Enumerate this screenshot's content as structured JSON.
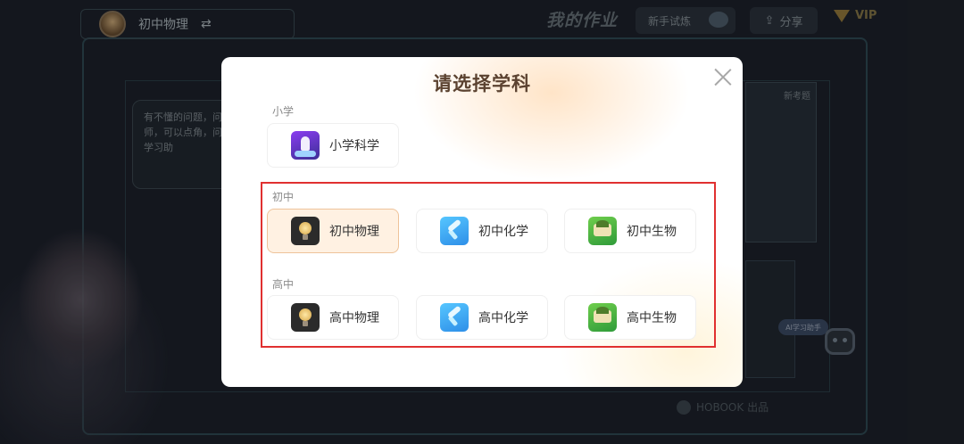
{
  "background": {
    "topbar": {
      "current_subject": "初中物理"
    },
    "page_title": "我的作业",
    "practice_label": "新手试炼",
    "share_label": "分享",
    "vip_label": "VIP",
    "chat_bubble_text": "有不懂的问题，问老师，可以点角，问AI学习助",
    "side_panel_label": "新考题",
    "bot_chip_label": "AI学习助手",
    "footer_label": "HOBOOK 出品"
  },
  "modal": {
    "title": "请选择学科",
    "sections": [
      {
        "label": "小学",
        "items": [
          {
            "name": "小学科学",
            "icon": "science-icon"
          }
        ]
      },
      {
        "label": "初中",
        "items": [
          {
            "name": "初中物理",
            "icon": "physics-icon",
            "selected": true
          },
          {
            "name": "初中化学",
            "icon": "chemistry-icon"
          },
          {
            "name": "初中生物",
            "icon": "biology-icon"
          }
        ]
      },
      {
        "label": "高中",
        "items": [
          {
            "name": "高中物理",
            "icon": "physics-icon"
          },
          {
            "name": "高中化学",
            "icon": "chemistry-icon"
          },
          {
            "name": "高中生物",
            "icon": "biology-icon"
          }
        ]
      }
    ]
  },
  "colors": {
    "highlight_box": "#e03030",
    "selected_card_bg": "#fff1e2",
    "title_color": "#5b4230"
  }
}
